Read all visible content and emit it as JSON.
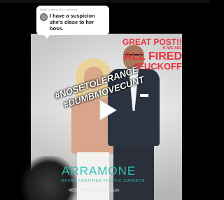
{
  "reply": {
    "header": "Reply to heme.vux's comment",
    "comment": "I have a suspicion she's close to her boss."
  },
  "overlay": {
    "line1": "GREAT POST!!",
    "line2": "IF WE ARE",
    "line3": "ALL FIRED",
    "line4": "#FUCKOFF"
  },
  "tags": {
    "line1": "#NOSETOLERANCE",
    "line2": "#DUMBMOVECUNT"
  },
  "brand": {
    "name": "ARRAMONE",
    "subtitle": "BOARD CERTIFIED PLASTIC SURGEON",
    "contact": "4651 1900 • arramone.com"
  },
  "colors": {
    "accent_red": "#e8323b",
    "brand_teal": "#2fc2b5"
  },
  "icons": {
    "play": "play-icon",
    "avatar": "avatar"
  }
}
